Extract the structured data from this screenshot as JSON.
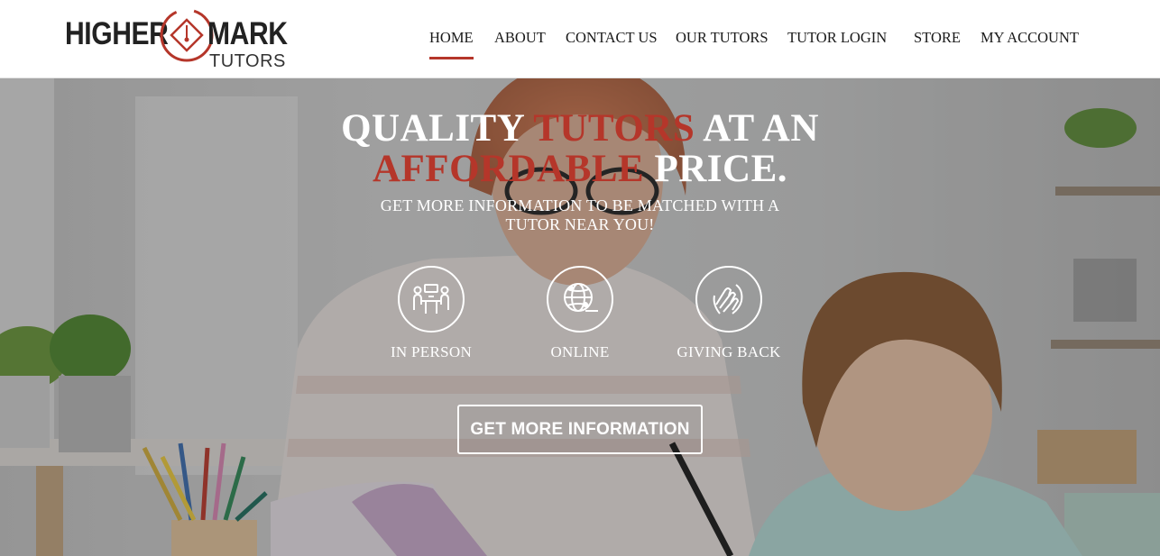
{
  "brand": {
    "word_left": "HIGHER",
    "word_right": "MARK",
    "word_bottom": "TUTORS",
    "accent_color": "#b5362a"
  },
  "nav": {
    "items": [
      {
        "label": "HOME",
        "active": true
      },
      {
        "label": "ABOUT"
      },
      {
        "label": "CONTACT US"
      },
      {
        "label": "OUR TUTORS"
      },
      {
        "label": "TUTOR LOGIN"
      },
      {
        "label": "STORE"
      },
      {
        "label": "MY ACCOUNT"
      }
    ]
  },
  "hero": {
    "headline_part1": "QUALITY ",
    "headline_accent1": "TUTORS",
    "headline_part2": " AT AN",
    "headline_accent2": "AFFORDABLE",
    "headline_part3": " PRICE.",
    "subline_line1": "GET MORE INFORMATION TO BE MATCHED WITH A",
    "subline_line2": "TUTOR NEAR YOU!",
    "features": [
      {
        "label": "IN PERSON",
        "icon": "people-at-table-icon"
      },
      {
        "label": "ONLINE",
        "icon": "globe-network-icon"
      },
      {
        "label": "GIVING BACK",
        "icon": "hands-giving-icon"
      }
    ],
    "cta_label": "GET MORE INFORMATION"
  }
}
